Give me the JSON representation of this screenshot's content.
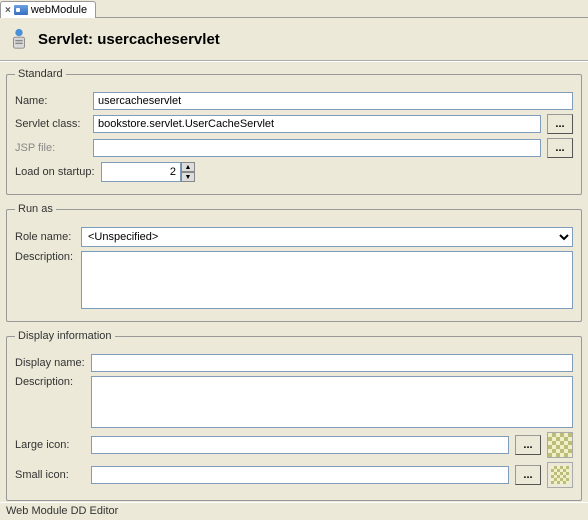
{
  "tab": {
    "label": "webModule"
  },
  "header": {
    "title": "Servlet: usercacheservlet"
  },
  "standard": {
    "legend": "Standard",
    "name_label": "Name:",
    "name_value": "usercacheservlet",
    "class_label": "Servlet class:",
    "class_value": "bookstore.servlet.UserCacheServlet",
    "jsp_label": "JSP file:",
    "jsp_value": "",
    "load_label": "Load on startup:",
    "load_value": "2",
    "browse": "..."
  },
  "runas": {
    "legend": "Run as",
    "role_label": "Role name:",
    "role_value": "<Unspecified>",
    "desc_label": "Description:",
    "desc_value": ""
  },
  "display": {
    "legend": "Display information",
    "name_label": "Display name:",
    "name_value": "",
    "desc_label": "Description:",
    "desc_value": "",
    "large_label": "Large icon:",
    "large_value": "",
    "small_label": "Small icon:",
    "small_value": "",
    "browse": "..."
  },
  "status": {
    "text": "Web Module DD Editor"
  }
}
